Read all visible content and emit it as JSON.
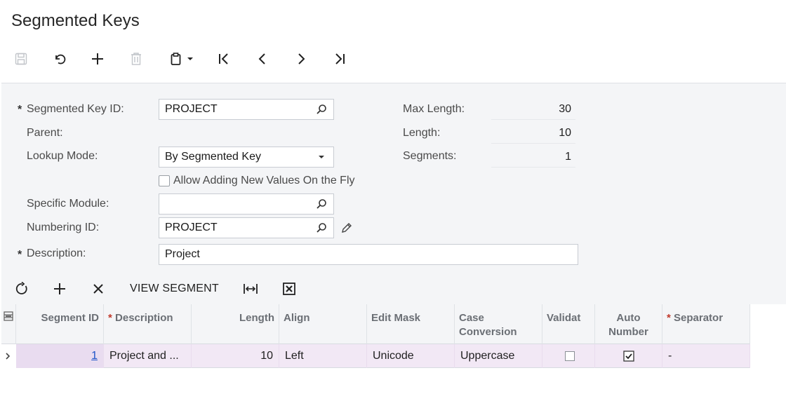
{
  "page": {
    "title": "Segmented Keys"
  },
  "form": {
    "segmented_key_id": {
      "label": "Segmented Key ID:",
      "value": "PROJECT"
    },
    "parent": {
      "label": "Parent:"
    },
    "lookup_mode": {
      "label": "Lookup Mode:",
      "value": "By Segmented Key"
    },
    "allow_adding": {
      "label": "Allow Adding New Values On the Fly"
    },
    "specific_module": {
      "label": "Specific Module:",
      "value": ""
    },
    "numbering_id": {
      "label": "Numbering ID:",
      "value": "PROJECT"
    },
    "description": {
      "label": "Description:",
      "value": "Project"
    },
    "max_length": {
      "label": "Max Length:",
      "value": "30"
    },
    "length": {
      "label": "Length:",
      "value": "10"
    },
    "segments": {
      "label": "Segments:",
      "value": "1"
    }
  },
  "grid_toolbar": {
    "view_segment": "VIEW SEGMENT"
  },
  "grid": {
    "headers": {
      "segment_id": "Segment ID",
      "description": "Description",
      "length": "Length",
      "align": "Align",
      "edit_mask": "Edit Mask",
      "case_line1": "Case",
      "case_line2": "Conversion",
      "validate": "Validat",
      "auto_line1": "Auto",
      "auto_line2": "Number",
      "separator": "Separator"
    },
    "rows": [
      {
        "segment_id": "1",
        "description": "Project and ...",
        "length": "10",
        "align": "Left",
        "edit_mask": "Unicode",
        "case_conversion": "Uppercase",
        "separator": "-"
      }
    ]
  },
  "colors": {
    "row_selected": "#f2e8f5",
    "link": "#1f55c8",
    "required": "#c0392b"
  }
}
